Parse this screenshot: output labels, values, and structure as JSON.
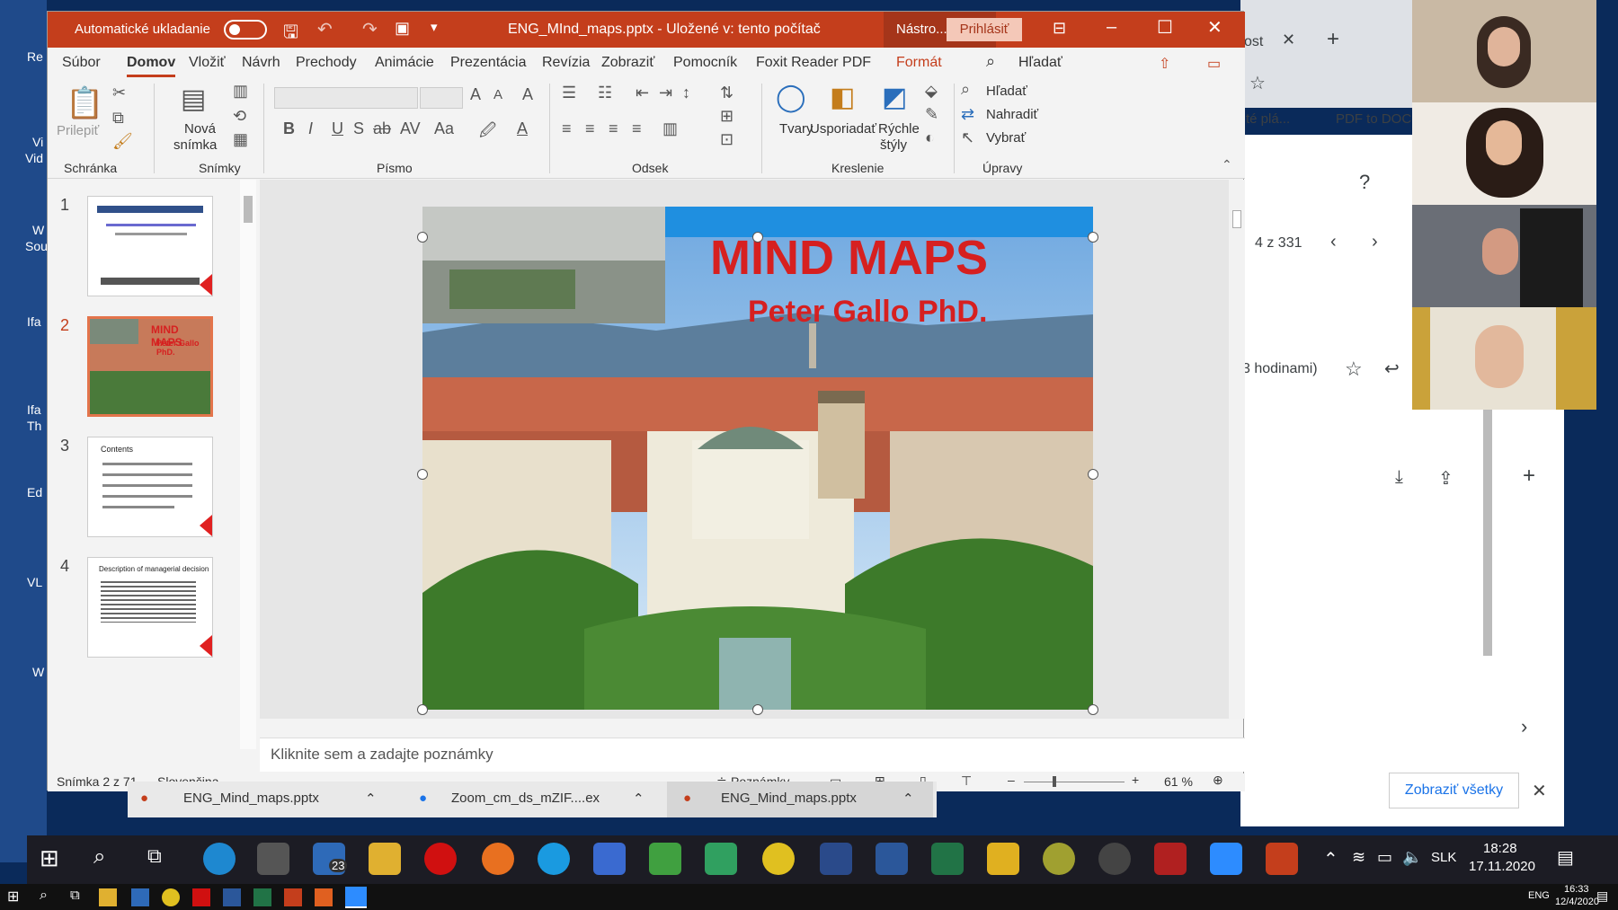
{
  "window": {
    "autosave_label": "Automatické ukladanie",
    "title": "ENG_MInd_maps.pptx  -  Uložené v: tento počítač",
    "tools_label": "Nástro...",
    "signin_label": "Prihlásiť"
  },
  "tabs": [
    "Súbor",
    "Domov",
    "Vložiť",
    "Návrh",
    "Prechody",
    "Animácie",
    "Prezentácia",
    "Revízia",
    "Zobraziť",
    "Pomocník",
    "Foxit Reader PDF",
    "Formát"
  ],
  "search_label": "Hľadať",
  "ribbon": {
    "clipboard": {
      "paste": "Prilepiť",
      "group": "Schránka"
    },
    "slides": {
      "new_line1": "Nová",
      "new_line2": "snímka",
      "group": "Snímky"
    },
    "font_group": "Písmo",
    "paragraph_group": "Odsek",
    "drawing": {
      "shapes": "Tvary",
      "arrange": "Usporiadať",
      "quick_line1": "Rýchle",
      "quick_line2": "štýly",
      "group": "Kreslenie"
    },
    "editing": {
      "find": "Hľadať",
      "replace": "Nahradiť",
      "select": "Vybrať",
      "group": "Úpravy"
    }
  },
  "thumbnails": [
    {
      "num": "1"
    },
    {
      "num": "2",
      "title": "MIND MAPS",
      "subtitle": "Peter Gallo PhD."
    },
    {
      "num": "3",
      "heading": "Contents"
    },
    {
      "num": "4",
      "heading": "Description of managerial decision"
    }
  ],
  "slide": {
    "title": "MIND MAPS",
    "subtitle": "Peter Gallo PhD."
  },
  "notes_placeholder": "Kliknite sem a zadajte poznámky",
  "status": {
    "slide": "Snímka 2 z 71",
    "language": "Slovenčina",
    "notes": "Poznámky",
    "zoom": "61 %"
  },
  "downloads": [
    {
      "name": "ENG_Mind_maps.pptx"
    },
    {
      "name": "Zoom_cm_ds_mZIF....ex"
    },
    {
      "name": "ENG_Mind_maps.pptx"
    }
  ],
  "chrome": {
    "tab_partial": "ost",
    "bookmark1": "té plá...",
    "bookmark2": "PDF to DOC",
    "pages": "4 z 331",
    "time_ago": "3 hodinami)",
    "show_all": "Zobraziť všetky"
  },
  "left_labels": [
    "Re",
    "Vi",
    "Vid",
    "W",
    "Sou",
    "Ifa",
    "Ifa",
    "Th",
    "Ed",
    "VL",
    "W"
  ],
  "taskbar": {
    "lang": "SLK",
    "time": "18:28",
    "date": "17.11.2020",
    "badge": "23"
  },
  "taskbar2": {
    "lang": "ENG",
    "time": "16:33",
    "date": "12/4/2020"
  }
}
